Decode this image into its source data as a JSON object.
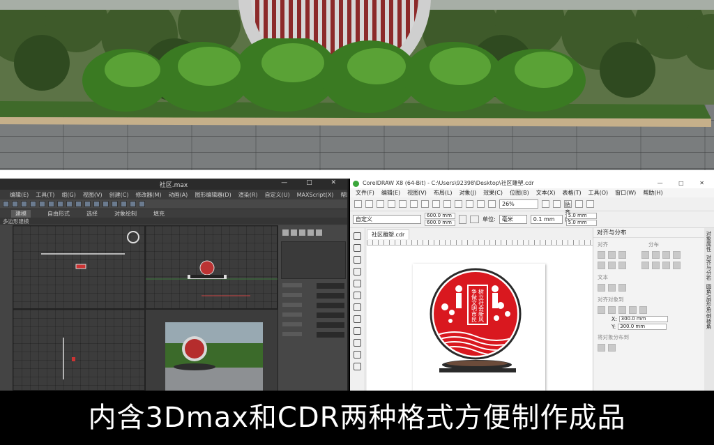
{
  "render": {
    "description_icon": "signboard-3d-render"
  },
  "max": {
    "title": "社区.max",
    "window_controls": "—  □  ✕",
    "menu": [
      "编辑(E)",
      "工具(T)",
      "组(G)",
      "视图(V)",
      "创建(C)",
      "修改器(M)",
      "动画(A)",
      "图形编辑器(D)",
      "渲染(R)",
      "自定义(U)",
      "MAXScript(X)",
      "帮助(H)"
    ],
    "ribbon": [
      "建模",
      "自由形式",
      "选择",
      "对象绘制",
      "填充"
    ],
    "subtab": "多边形建模"
  },
  "cdr": {
    "title": "CorelDRAW X8 (64-Bit) - C:\\Users\\92398\\Desktop\\社区雕塑.cdr",
    "window_controls": "—  □  ✕",
    "menu": [
      "文件(F)",
      "编辑(E)",
      "视图(V)",
      "布局(L)",
      "对象(J)",
      "效果(C)",
      "位图(B)",
      "文本(X)",
      "表格(T)",
      "工具(O)",
      "窗口(W)",
      "帮助(H)"
    ],
    "zoom": "26%",
    "snap": "贴齐(T)",
    "preset": "自定义",
    "width": "600.0 mm",
    "height": "600.0 mm",
    "unit_label": "单位:",
    "unit": "毫米",
    "nudge": "0.1 mm",
    "dup_x": "5.0 mm",
    "dup_y": "5.0 mm",
    "doc_tab": "社区雕塑.cdr",
    "docker": {
      "title": "对齐与分布",
      "sec_align": "对齐",
      "sec_dist": "分布",
      "sec_text": "文本",
      "sec_obj": "对齐对象到",
      "x_value": "300.0 mm",
      "y_value": "300.0 mm",
      "sec_dist_to": "将对象分布到"
    },
    "side_tabs": [
      "对象属性",
      "对齐与分布",
      "圆角/扇形角/倒棱角"
    ],
    "sign": {
      "vertical_text_1": "争做文明市民",
      "vertical_text_2": "树立社会新风"
    }
  },
  "caption": "内含3Dmax和CDR两种格式方便制作成品",
  "colors": {
    "sign_red": "#d9181f",
    "base": "#2a2a2a"
  }
}
